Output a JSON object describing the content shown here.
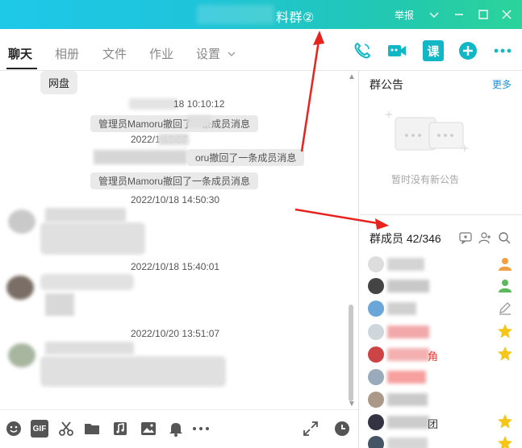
{
  "window": {
    "title": "料群②",
    "report_label": "举报"
  },
  "tabs": [
    {
      "label": "聊天",
      "active": true
    },
    {
      "label": "相册",
      "active": false
    },
    {
      "label": "文件",
      "active": false
    },
    {
      "label": "作业",
      "active": false
    },
    {
      "label": "设置",
      "active": false
    }
  ],
  "header_actions": [
    "phone-icon",
    "video-icon",
    "lesson-icon",
    "add-app-icon",
    "more-icon"
  ],
  "header_action_labels": {
    "lesson": "课"
  },
  "chat": {
    "top_bubble": "网盘",
    "messages": [
      {
        "type": "timestamp",
        "text": "18 10:10:12"
      },
      {
        "type": "system",
        "text": "管理员Mamoru撤回了一条成员消息"
      },
      {
        "type": "timestamp",
        "text": "2022/1 10:37"
      },
      {
        "type": "system",
        "text": "oru撤回了一条成员消息"
      },
      {
        "type": "system",
        "text": "管理员Mamoru撤回了一条成员消息"
      },
      {
        "type": "timestamp",
        "text": "2022/10/18 14:50:30"
      },
      {
        "type": "timestamp",
        "text": "2022/10/18 15:40:01"
      },
      {
        "type": "timestamp",
        "text": "2022/10/20 13:51:07"
      }
    ]
  },
  "toolbar": [
    "emoji-icon",
    "gif-icon",
    "scissors-icon",
    "folder-icon",
    "music-icon",
    "image-icon",
    "bell-icon",
    "more-dots-icon",
    "expand-icon",
    "clock-icon"
  ],
  "toolbar_labels": {
    "gif": "GIF"
  },
  "notice": {
    "title": "群公告",
    "more_label": "更多",
    "empty_text": "暂时没有新公告"
  },
  "members": {
    "title": "群成员 42/346",
    "rows": [
      {
        "role": "owner",
        "role_color": "#f0a040"
      },
      {
        "role": "admin",
        "role_color": "#5cb85c"
      },
      {
        "role": "edit",
        "role_color": "#999999"
      },
      {
        "role": "star",
        "role_color": "#f5c518"
      },
      {
        "role": "star",
        "role_color": "#f5c518"
      },
      {
        "role": "none",
        "role_color": ""
      },
      {
        "role": "none",
        "role_color": ""
      },
      {
        "role": "star",
        "role_color": "#f5c518"
      },
      {
        "role": "star",
        "role_color": "#f5c518"
      }
    ],
    "partial_names": [
      "角",
      "团"
    ]
  },
  "colors": {
    "accent": "#1e90d8",
    "action_teal": "#12b7c5",
    "title_gradient_start": "#1ec8e8",
    "title_gradient_end": "#2bd49a"
  }
}
